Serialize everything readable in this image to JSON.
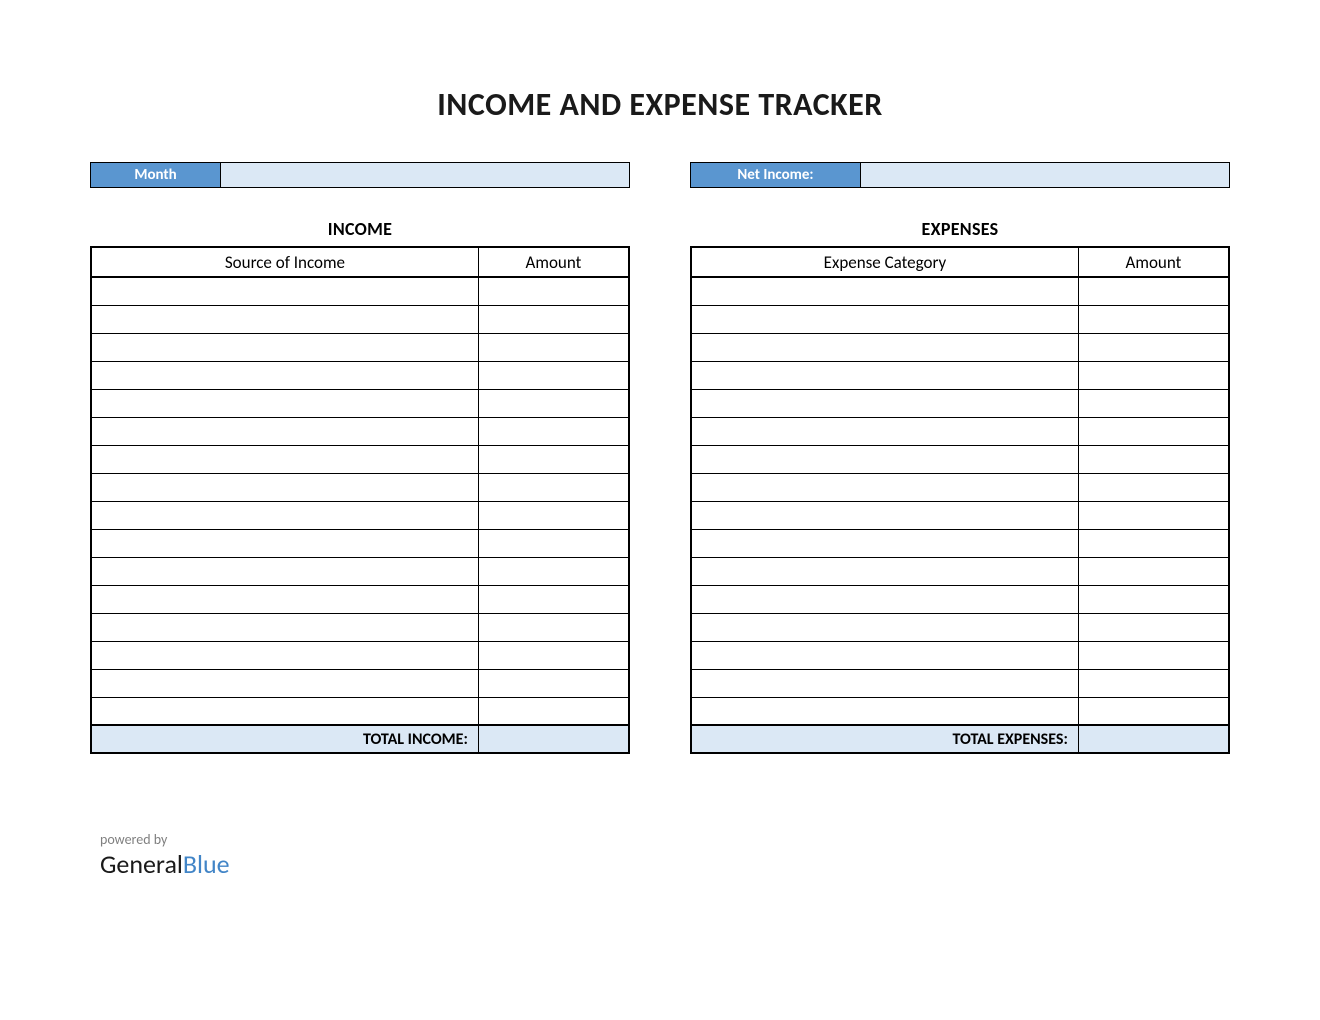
{
  "title": "INCOME AND EXPENSE TRACKER",
  "top": {
    "month_label": "Month",
    "month_value": "",
    "net_income_label": "Net Income:",
    "net_income_value": ""
  },
  "income": {
    "section_title": "INCOME",
    "col_desc": "Source of Income",
    "col_amount": "Amount",
    "rows": [
      {
        "desc": "",
        "amount": ""
      },
      {
        "desc": "",
        "amount": ""
      },
      {
        "desc": "",
        "amount": ""
      },
      {
        "desc": "",
        "amount": ""
      },
      {
        "desc": "",
        "amount": ""
      },
      {
        "desc": "",
        "amount": ""
      },
      {
        "desc": "",
        "amount": ""
      },
      {
        "desc": "",
        "amount": ""
      },
      {
        "desc": "",
        "amount": ""
      },
      {
        "desc": "",
        "amount": ""
      },
      {
        "desc": "",
        "amount": ""
      },
      {
        "desc": "",
        "amount": ""
      },
      {
        "desc": "",
        "amount": ""
      },
      {
        "desc": "",
        "amount": ""
      },
      {
        "desc": "",
        "amount": ""
      },
      {
        "desc": "",
        "amount": ""
      }
    ],
    "total_label": "TOTAL INCOME:",
    "total_value": ""
  },
  "expenses": {
    "section_title": "EXPENSES",
    "col_desc": "Expense Category",
    "col_amount": "Amount",
    "rows": [
      {
        "desc": "",
        "amount": ""
      },
      {
        "desc": "",
        "amount": ""
      },
      {
        "desc": "",
        "amount": ""
      },
      {
        "desc": "",
        "amount": ""
      },
      {
        "desc": "",
        "amount": ""
      },
      {
        "desc": "",
        "amount": ""
      },
      {
        "desc": "",
        "amount": ""
      },
      {
        "desc": "",
        "amount": ""
      },
      {
        "desc": "",
        "amount": ""
      },
      {
        "desc": "",
        "amount": ""
      },
      {
        "desc": "",
        "amount": ""
      },
      {
        "desc": "",
        "amount": ""
      },
      {
        "desc": "",
        "amount": ""
      },
      {
        "desc": "",
        "amount": ""
      },
      {
        "desc": "",
        "amount": ""
      },
      {
        "desc": "",
        "amount": ""
      }
    ],
    "total_label": "TOTAL EXPENSES:",
    "total_value": ""
  },
  "footer": {
    "powered_by": "powered by",
    "brand_general": "General",
    "brand_blue": "Blue"
  }
}
